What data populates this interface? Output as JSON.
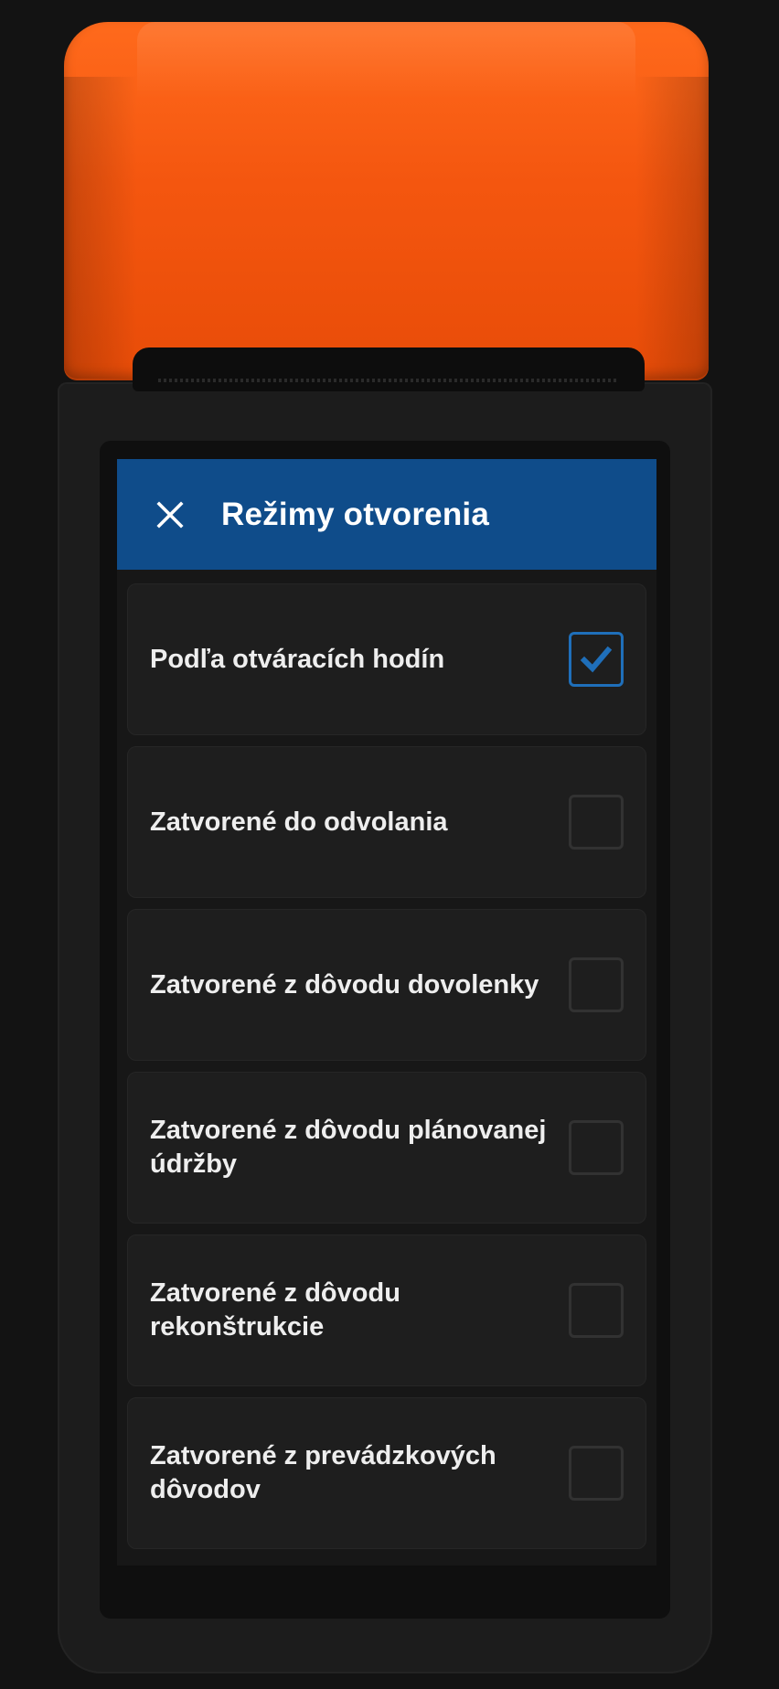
{
  "colors": {
    "accent": "#0f4c8a",
    "checkbox_checked": "#1f6fba",
    "printer_cap": "#f4560f",
    "screen_bg": "#171717"
  },
  "header": {
    "close_icon": "close-icon",
    "title": "Režimy otvorenia"
  },
  "options": [
    {
      "label": "Podľa otváracích hodín",
      "checked": true
    },
    {
      "label": "Zatvorené do odvolania",
      "checked": false
    },
    {
      "label": "Zatvorené z dôvodu dovolenky",
      "checked": false
    },
    {
      "label": "Zatvorené z dôvodu plánovanej údržby",
      "checked": false
    },
    {
      "label": "Zatvorené z dôvodu rekonštrukcie",
      "checked": false
    },
    {
      "label": "Zatvorené z prevádzkových dôvodov",
      "checked": false
    }
  ]
}
